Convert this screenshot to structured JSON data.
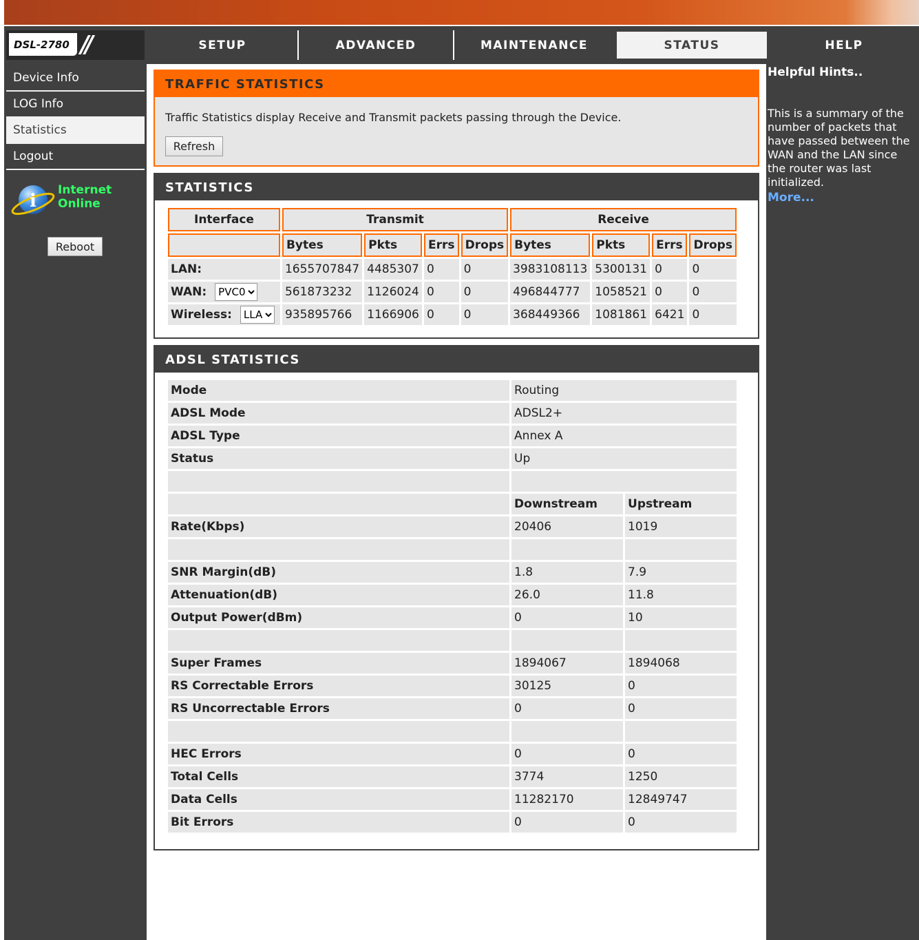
{
  "logo": {
    "model": "DSL-2780"
  },
  "nav": {
    "tabs": [
      "SETUP",
      "ADVANCED",
      "MAINTENANCE",
      "STATUS",
      "HELP"
    ],
    "active": "STATUS"
  },
  "sidebar": {
    "items": [
      "Device Info",
      "LOG Info",
      "Statistics",
      "Logout"
    ],
    "active": "Statistics",
    "internet_label": "Internet",
    "online_label": "Online",
    "reboot_label": "Reboot"
  },
  "traffic": {
    "title": "TRAFFIC STATISTICS",
    "description": "Traffic Statistics display Receive and Transmit packets passing through the Device.",
    "refresh_label": "Refresh"
  },
  "statistics": {
    "title": "STATISTICS",
    "group_headers": [
      "Interface",
      "Transmit",
      "Receive"
    ],
    "sub_headers": [
      "Bytes",
      "Pkts",
      "Errs",
      "Drops",
      "Bytes",
      "Pkts",
      "Errs",
      "Drops"
    ],
    "rows": [
      {
        "interface": "LAN:",
        "select": null,
        "values": [
          "1655707847",
          "4485307",
          "0",
          "0",
          "3983108113",
          "5300131",
          "0",
          "0"
        ]
      },
      {
        "interface": "WAN:",
        "select": "PVC0",
        "values": [
          "561873232",
          "1126024",
          "0",
          "0",
          "496844777",
          "1058521",
          "0",
          "0"
        ]
      },
      {
        "interface": "Wireless:",
        "select": "LLA",
        "values": [
          "935895766",
          "1166906",
          "0",
          "0",
          "368449366",
          "1081861",
          "6421",
          "0"
        ]
      }
    ]
  },
  "adsl": {
    "title": "ADSL STATISTICS",
    "single_rows": [
      {
        "label": "Mode",
        "value": "Routing"
      },
      {
        "label": "ADSL Mode",
        "value": "ADSL2+"
      },
      {
        "label": "ADSL Type",
        "value": "Annex A"
      },
      {
        "label": "Status",
        "value": "Up"
      }
    ],
    "columns": [
      "Downstream",
      "Upstream"
    ],
    "pair_rows": [
      {
        "label": "Rate(Kbps)",
        "down": "20406",
        "up": "1019"
      },
      null,
      {
        "label": "SNR Margin(dB)",
        "down": "1.8",
        "up": "7.9"
      },
      {
        "label": "Attenuation(dB)",
        "down": "26.0",
        "up": "11.8"
      },
      {
        "label": "Output Power(dBm)",
        "down": "0",
        "up": "10"
      },
      null,
      {
        "label": "Super Frames",
        "down": "1894067",
        "up": "1894068"
      },
      {
        "label": "RS Correctable Errors",
        "down": "30125",
        "up": "0"
      },
      {
        "label": "RS Uncorrectable Errors",
        "down": "0",
        "up": "0"
      },
      null,
      {
        "label": "HEC Errors",
        "down": "0",
        "up": "0"
      },
      {
        "label": "Total Cells",
        "down": "3774",
        "up": "1250"
      },
      {
        "label": "Data Cells",
        "down": "11282170",
        "up": "12849747"
      },
      {
        "label": "Bit Errors",
        "down": "0",
        "up": "0"
      }
    ]
  },
  "help": {
    "title": "Helpful Hints..",
    "text": "This is a summary of the number of packets that have passed between the WAN and the LAN since the router was last initialized.",
    "more_label": "More..."
  },
  "colors": {
    "accent": "#ff6a00",
    "dark": "#404040",
    "cell": "#e6e6e6",
    "online": "#33ff66",
    "link": "#6aaeff"
  }
}
